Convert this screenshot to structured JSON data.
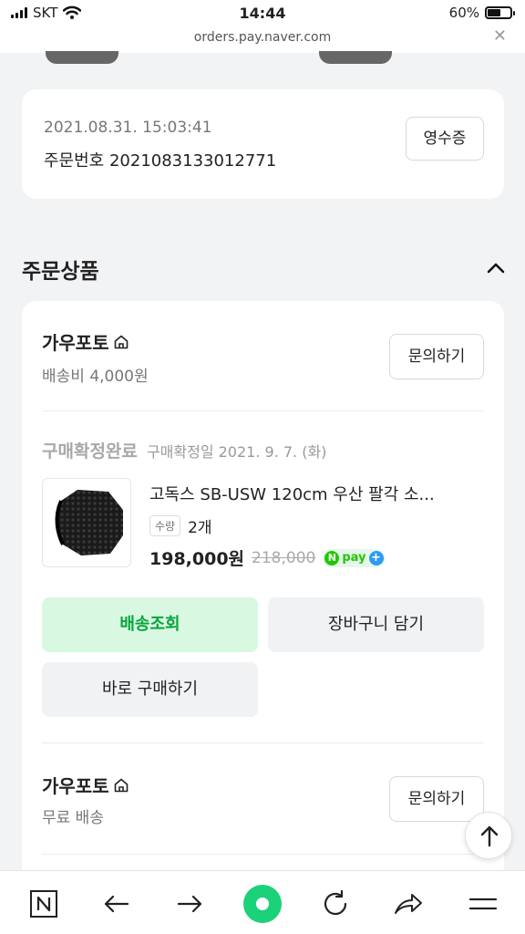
{
  "status_bar": {
    "carrier": "SKT",
    "time": "14:44",
    "battery_percent": "60%",
    "battery_level": 0.6
  },
  "browser": {
    "url": "orders.pay.naver.com",
    "close_icon": "close-icon"
  },
  "order_info": {
    "date": "2021.08.31. 15:03:41",
    "order_number": "주문번호 2021083133012771",
    "receipt_button": "영수증"
  },
  "section": {
    "title": "주문상품",
    "toggle_icon": "chevron-up-icon"
  },
  "stores": [
    {
      "name": "가우포토",
      "shipping": "배송비 4,000원",
      "inquire_button": "문의하기",
      "items": [
        {
          "status": "구매확정완료",
          "confirm_date": "구매확정일 2021. 9. 7. (화)",
          "name": "고독스 SB-USW 120cm 우산 팔각 소...",
          "qty_label": "수량",
          "qty": "2개",
          "price": "198,000원",
          "original_price": "218,000",
          "npay_label": "pay",
          "buttons": {
            "track": "배송조회",
            "cart": "장바구니 담기",
            "buy": "바로 구매하기"
          }
        }
      ]
    },
    {
      "name": "가우포토",
      "shipping": "무료 배송",
      "inquire_button": "문의하기"
    }
  ],
  "colors": {
    "accent_green": "#07a53c",
    "npay_green": "#1ec800",
    "npay_blue": "#2f9bf0"
  },
  "toolbar": {
    "items": [
      "naver-home-icon",
      "back-arrow-icon",
      "forward-arrow-icon",
      "green-circle-icon",
      "reload-icon",
      "share-icon",
      "menu-icon"
    ]
  }
}
